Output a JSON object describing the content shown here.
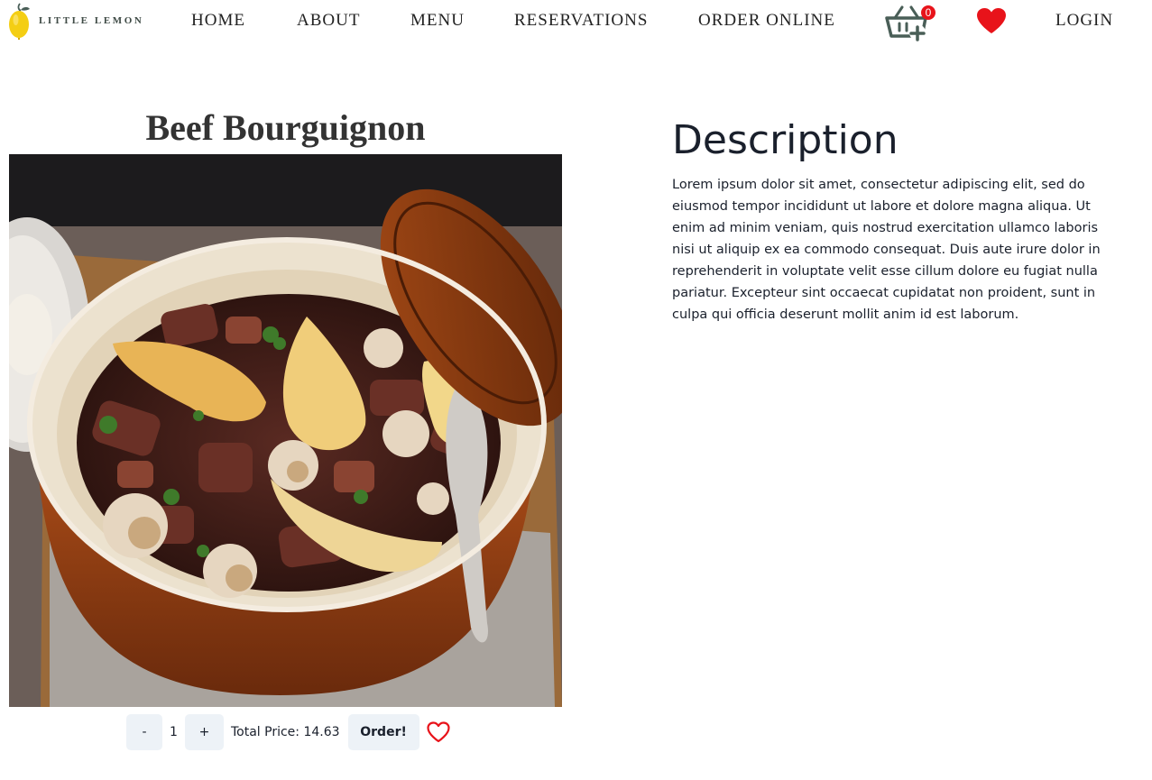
{
  "nav": {
    "brand": "LITTLE LEMON",
    "links": [
      "HOME",
      "ABOUT",
      "MENU",
      "RESERVATIONS",
      "ORDER ONLINE",
      "LOGIN"
    ],
    "cart_count": "0",
    "icons": {
      "logo": "lemon-logo-icon",
      "cart": "basket-add-icon",
      "favorites": "heart-filled-icon"
    }
  },
  "product": {
    "title": "Beef Bourguignon",
    "image_icon": "dish-photo",
    "minus_label": "-",
    "quantity": "1",
    "plus_label": "+",
    "total_label": "Total Price:",
    "total_value": "14.63",
    "order_label": "Order!",
    "favorite_icon": "heart-outline-icon"
  },
  "description": {
    "heading": "Description",
    "body": "Lorem ipsum dolor sit amet, consectetur adipiscing elit, sed do eiusmod tempor incididunt ut labore et dolore magna aliqua. Ut enim ad minim veniam, quis nostrud exercitation ullamco laboris nisi ut aliquip ex ea commodo consequat. Duis aute irure dolor in reprehenderit in voluptate velit esse cillum dolore eu fugiat nulla pariatur. Excepteur sint occaecat cupidatat non proident, sunt in culpa qui officia deserunt mollit anim id est laborum."
  },
  "colors": {
    "accent_red": "#e8131a",
    "button_bg": "#edf2f7",
    "text_dark": "#1a202c",
    "logo_lemon": "#f4ce14",
    "logo_green": "#495e57"
  }
}
